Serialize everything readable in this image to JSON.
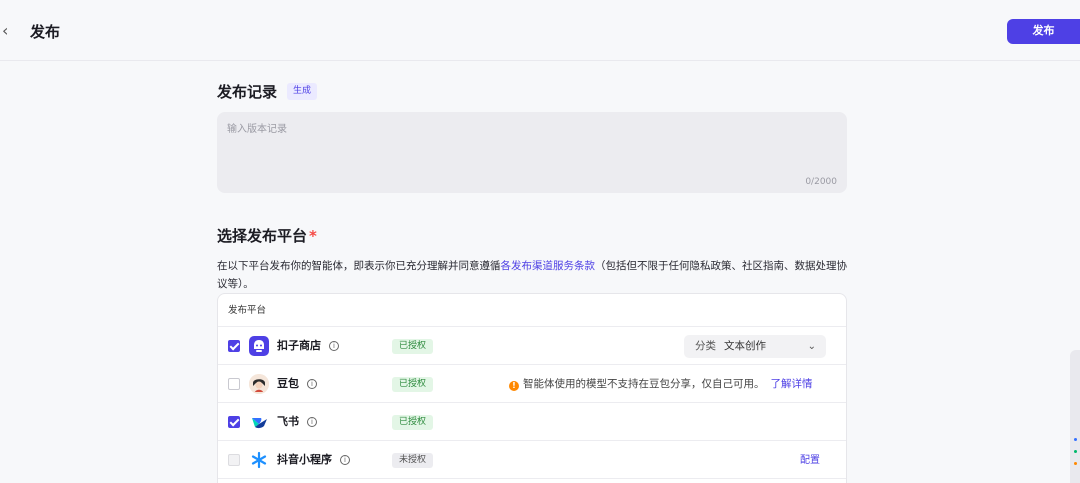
{
  "header": {
    "back_icon": "chevron-left-icon",
    "title": "发布",
    "publish_label": "发布",
    "accent": "#4e40e5"
  },
  "record": {
    "title": "发布记录",
    "generate_label": "生成",
    "placeholder": "输入版本记录",
    "value": "",
    "counter": "0/2000"
  },
  "platforms": {
    "title": "选择发布平台",
    "required_mark": "*",
    "desc_before": "在以下平台发布你的智能体，即表示你已充分理解并同意遵循",
    "desc_link": "各发布渠道服务条款",
    "desc_after": "（包括但不限于任何隐私政策、社区指南、数据处理协议等）。",
    "column_header": "发布平台",
    "rows": [
      {
        "name": "扣子商店",
        "checked": true,
        "status": "已授权",
        "category_label": "分类",
        "category_value": "文本创作",
        "icon": "coze-store-icon"
      },
      {
        "name": "豆包",
        "checked": false,
        "status": "已授权",
        "warning": "智能体使用的模型不支持在豆包分享，仅自己可用。",
        "warning_link": "了解详情",
        "icon": "doubao-avatar-icon"
      },
      {
        "name": "飞书",
        "checked": true,
        "status": "已授权",
        "icon": "feishu-icon"
      },
      {
        "name": "抖音小程序",
        "checked": false,
        "disabled": true,
        "status": "未授权",
        "action": "配置",
        "icon": "douyin-mini-program-icon"
      }
    ]
  }
}
